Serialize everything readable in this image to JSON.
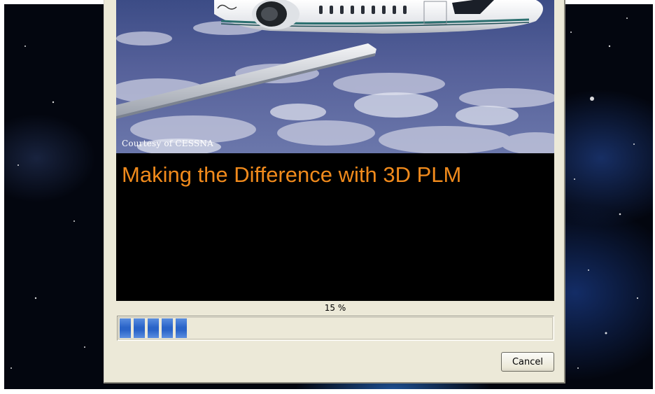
{
  "splash": {
    "photo_credit": "Courtesy of CESSNA",
    "aircraft_script_mark": "Citation X",
    "headline": "Making the Difference with 3D PLM",
    "headline_color": "#f08a1c"
  },
  "progress": {
    "percent_label": "15 %",
    "value_percent": 15,
    "bar_color": "#2a64c8"
  },
  "buttons": {
    "cancel_label": "Cancel"
  }
}
